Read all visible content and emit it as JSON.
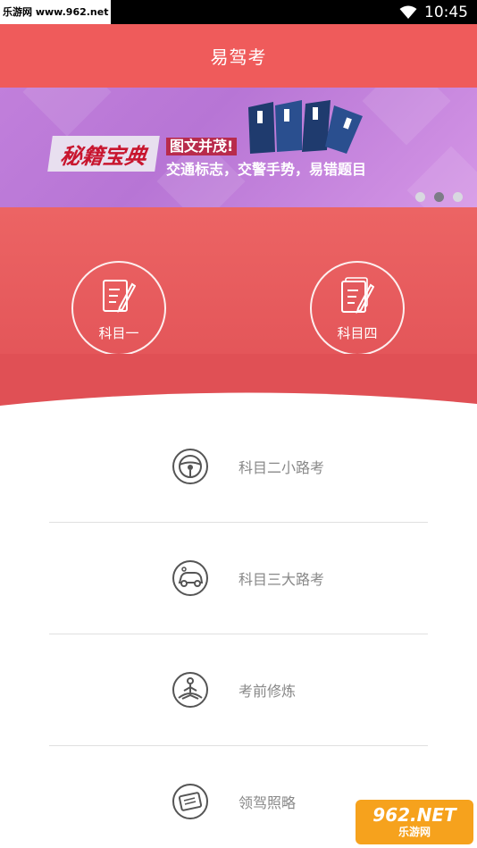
{
  "status_bar": {
    "watermark": "乐游网 www.962.net",
    "time": "10:45",
    "wifi_icon": "wifi-icon"
  },
  "app_bar": {
    "title": "易驾考"
  },
  "banner": {
    "calligraphy": "秘籍宝典",
    "headline": "图文并茂!",
    "subline": "交通标志，交警手势，易错题目",
    "dots": 3,
    "active_dot": 2
  },
  "subjects": [
    {
      "label": "科目一",
      "icon": "exam-paper-pencil-icon"
    },
    {
      "label": "科目四",
      "icon": "exam-paper-pencil-icon"
    }
  ],
  "menu": [
    {
      "label": "科目二小路考",
      "icon": "steering-wheel-icon"
    },
    {
      "label": "科目三大路考",
      "icon": "car-icon"
    },
    {
      "label": "考前修炼",
      "icon": "meditation-icon"
    },
    {
      "label": "领驾照略",
      "icon": "license-card-icon"
    }
  ],
  "footer_badge": {
    "top": "962.NET",
    "bottom": "乐游网"
  },
  "colors": {
    "brand_red": "#ef5b5b",
    "banner_purple": "#c17fdb",
    "menu_text": "#888888",
    "icon_gray": "#555555"
  }
}
